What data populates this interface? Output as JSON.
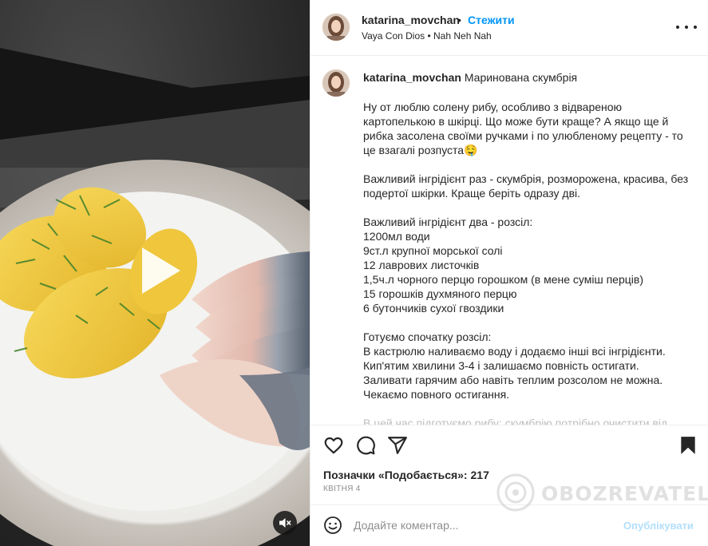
{
  "post": {
    "username": "katarina_movchan",
    "follow_label": "Стежити",
    "separator": "•",
    "music": "Vaya Con Dios • Nah Neh Nah"
  },
  "caption": {
    "username": "katarina_movchan",
    "title": "Маринована скумбрія",
    "paragraphs": [
      "Ну от люблю солену рибу, особливо з відвареною картопелькою в шкірці. Що може бути краще? А якщо ще й рибка засолена своїми ручками і по улюбленому рецепту - то це взагалі розпуста🤤",
      "Важливий інгрідієнт раз - скумбрія, розморожена, красива, без подертої шкірки. Краще беріть одразу дві.",
      "Важливий інгрідієнт два - розсіл:\n1200мл води\n9ст.л крупної морської солі\n12 лаврових листочків\n1,5ч.л чорного перцю горошком (в мене суміш перців)\n15 горошків духмяного перцю\n6 бутончиків сухої гвоздики",
      "Готуємо спочатку розсіл:\nВ кастрюлю наливаємо воду і додаємо інші всі інгрідієнти. Кип'ятим хвилини 3-4 і залишаємо повність остигати.\nЗаливати гарячим або навіть теплим розсолом не можна. Чекаємо повного остигання."
    ],
    "partial": "В цей час підготуємо рибу: скумбрію потрібно очистити від"
  },
  "stats": {
    "likes_label": "Позначки «Подобається»:",
    "likes_count": "217",
    "date": "КВІТНЯ 4"
  },
  "composer": {
    "placeholder": "Додайте коментар...",
    "publish_label": "Опублікувати"
  },
  "watermark": "OBOZREVATEL",
  "icons": {
    "like": "heart-icon",
    "comment": "comment-icon",
    "share": "send-icon",
    "save": "bookmark-icon",
    "emoji": "smiley-icon",
    "play": "play-icon",
    "mute": "muted-speaker-icon",
    "more": "more-dots-icon"
  },
  "colors": {
    "accent": "#0095f6",
    "publish_disabled": "#b2dffc",
    "text": "#262626",
    "muted": "#8e8e8e"
  }
}
